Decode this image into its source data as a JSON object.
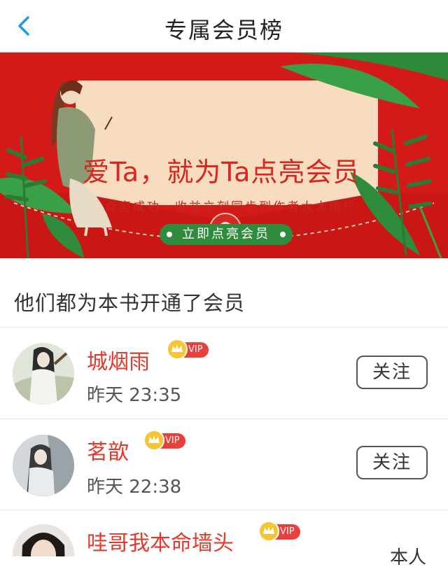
{
  "header": {
    "title": "专属会员榜",
    "back_icon": "chevron-left-icon"
  },
  "banner": {
    "headline": "爱Ta，就为Ta点亮会员",
    "subtitle": "点亮成功，收益立刻同步到作者大大账户",
    "cta_label": "立即点亮会员",
    "colors": {
      "background": "#d31a19",
      "card": "#f8dcc0",
      "cta": "#2e8c3c"
    }
  },
  "section": {
    "title": "他们都为本书开通了会员"
  },
  "members": [
    {
      "name": "城烟雨",
      "vip": "VIP",
      "time": "昨天 23:35",
      "action": "关注"
    },
    {
      "name": "茗歆",
      "vip": "VIP",
      "time": "昨天 22:38",
      "action": "关注"
    },
    {
      "name": "哇哥我本命墙头",
      "vip": "VIP",
      "time": "",
      "action": "本人"
    }
  ]
}
